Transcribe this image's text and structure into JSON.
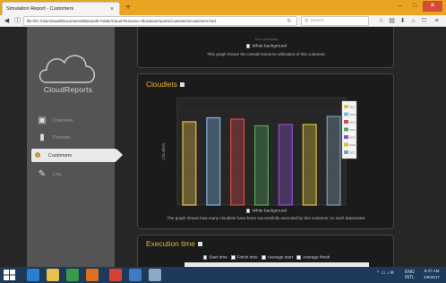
{
  "browser": {
    "tab_title": "Simulation Report - Customers",
    "tab_close": "×",
    "new_tab": "+",
    "url": "file:///C:/Users/swati/Documents/Bluetooth Folder/Cloud Resource Allocation/report1/customers/customers.html",
    "search_placeholder": "Search",
    "window_controls": {
      "minimize": "–",
      "maximize": "□",
      "close": "✕"
    }
  },
  "sidebar": {
    "logo_text": "CloudReports",
    "items": [
      {
        "label": "Overview",
        "icon": "overview-icon"
      },
      {
        "label": "Provider",
        "icon": "provider-icon"
      },
      {
        "label": "Customers",
        "icon": "customers-icon"
      },
      {
        "label": "Log",
        "icon": "log-icon"
      }
    ]
  },
  "top_panel": {
    "axis_hint": "Time (minutes)",
    "checkbox_label": "White background",
    "caption": "This graph shows the overall resource utilization of this customer."
  },
  "cloudlets_panel": {
    "title": "Cloudlets",
    "y_axis_label": "Cloudlets",
    "checkbox_label": "White background",
    "caption": "The graph shows how many cloudlets have been successfully executed by this customer on each datacenter."
  },
  "execution_panel": {
    "title": "Execution time",
    "options": [
      "Start time",
      "Finish time",
      "Average start",
      "Average finish"
    ]
  },
  "chart_data": {
    "type": "bar",
    "title": "",
    "categories": [
      "DC1",
      "DC2",
      "DC3",
      "DC4",
      "DC5",
      "DC6",
      "DC7"
    ],
    "values": [
      6.2,
      6.5,
      6.4,
      5.9,
      6.0,
      6.0,
      6.6
    ],
    "ylim": [
      0,
      8
    ],
    "ylabel": "Cloudlets",
    "grid": true,
    "legend": "top-right",
    "series_colors": [
      "#e9c24b",
      "#7fb6e8",
      "#d84a4a",
      "#55a655",
      "#8f4fd3",
      "#d9c23a",
      "#7f9fb6"
    ],
    "legend_entries": [
      "DC1",
      "DC2",
      "DC3",
      "DC4",
      "DC5",
      "DC6",
      "DC7"
    ]
  },
  "taskbar": {
    "apps": [
      "ie",
      "explorer",
      "store",
      "firefox",
      "chrome",
      "media",
      "app"
    ],
    "tray_lang": "ENG",
    "tray_region": "INTL",
    "time": "9:47 AM",
    "date": "4/9/2017"
  },
  "colors": {
    "accent": "#e8b52a",
    "tabbar": "#e9a521",
    "background": "#262626"
  }
}
